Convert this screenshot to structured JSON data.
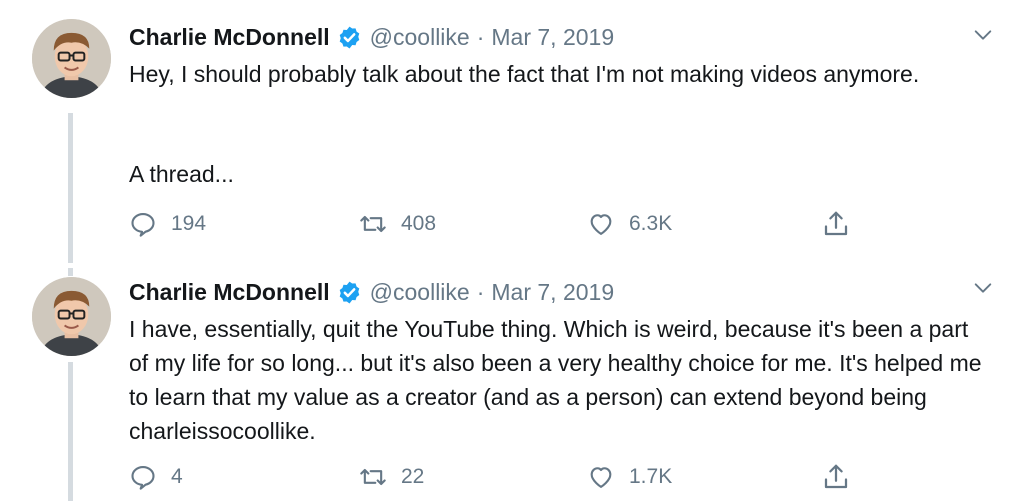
{
  "tweets": [
    {
      "author_name": "Charlie McDonnell",
      "handle": "@coollike",
      "separator": "·",
      "date": "Mar 7, 2019",
      "paragraph_1": "Hey, I should probably talk about the fact that I'm not making videos anymore.",
      "paragraph_2": "A thread...",
      "reply_count": "194",
      "retweet_count": "408",
      "like_count": "6.3K"
    },
    {
      "author_name": "Charlie McDonnell",
      "handle": "@coollike",
      "separator": "·",
      "date": "Mar 7, 2019",
      "paragraph_1": "I have, essentially, quit the YouTube thing. Which is weird, because it's been a part of my life for so long... but it's also been a very healthy choice for me. It's helped me to learn that my value as a creator (and as a person) can extend beyond being charleissocoollike.",
      "reply_count": "4",
      "retweet_count": "22",
      "like_count": "1.7K"
    }
  ],
  "icons": {
    "verified": "verified-badge-icon",
    "caret": "chevron-down-icon",
    "reply": "reply-icon",
    "retweet": "retweet-icon",
    "like": "heart-icon",
    "share": "share-icon"
  },
  "colors": {
    "verified_blue": "#1da1f2",
    "muted_text": "#657786",
    "thread_line": "#d5dbe0"
  }
}
